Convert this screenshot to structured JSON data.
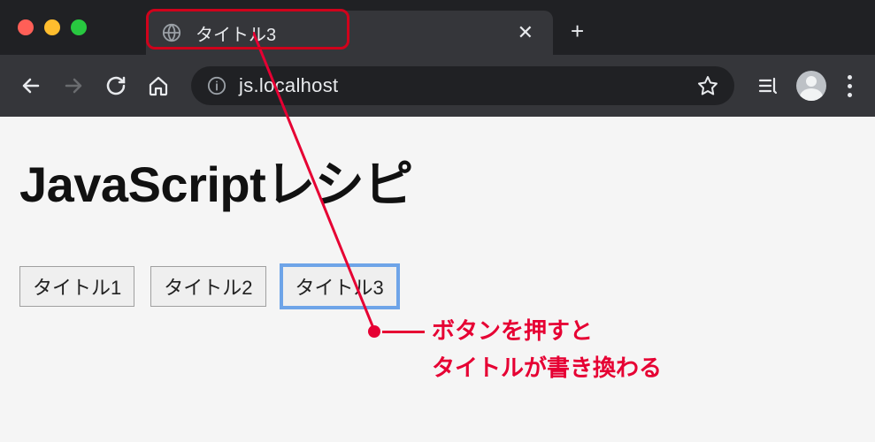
{
  "browser": {
    "tab_title": "タイトル3",
    "url": "js.localhost"
  },
  "page": {
    "heading": "JavaScriptレシピ",
    "buttons": [
      {
        "label": "タイトル1"
      },
      {
        "label": "タイトル2"
      },
      {
        "label": "タイトル3"
      }
    ]
  },
  "annotation": {
    "line1": "ボタンを押すと",
    "line2": "タイトルが書き換わる"
  }
}
